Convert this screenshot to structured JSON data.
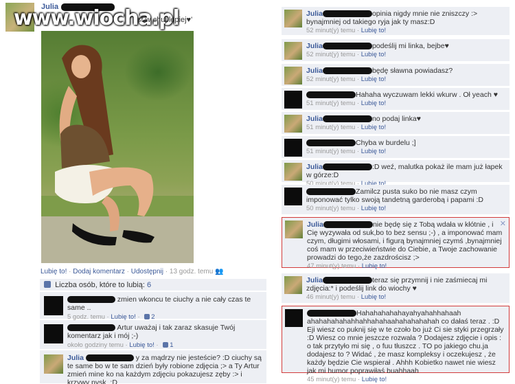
{
  "watermark": "www.wiocha.pl",
  "post": {
    "author": "Julia",
    "text": "st w chuj lepiej♥'",
    "actions": {
      "like": "Lubię to!",
      "comment": "Dodaj komentarz",
      "share": "Udostępnij",
      "time": "13 godz. temu"
    }
  },
  "likes": {
    "label": "Liczba osób, które to lubią:",
    "count": "6"
  },
  "left_comments": [
    {
      "author": "",
      "text": "zmien wkoncu te ciuchy a nie cały czas te same ..",
      "time": "5 godz. temu",
      "like": "Lubię to!",
      "likes": "2",
      "avatar": "dark"
    },
    {
      "author": "",
      "text": "Artur uważaj i tak zaraz skasuje Twój komentarz jak i mój ;-)",
      "time": "około godziny temu",
      "like": "Lubię to!",
      "likes": "1",
      "avatar": "dark"
    },
    {
      "author": "Julia",
      "text": "y za mądrzy nie jesteście? :D ciuchy są te same bo w te sam dzień były robione zdjęcia ;> a Ty Artur zmień mine ko na każdym zdjęciu pokazujesz zęby :> i krzywy pysk .:D",
      "time": "",
      "like": "",
      "likes": "",
      "avatar": "julia"
    }
  ],
  "right_comments": [
    {
      "author": "Julia",
      "text": "opinia nigdy mnie nie zniszczy :> bynajmniej od takiego ryja jak ty masz:D",
      "time": "52 minut(y) temu",
      "like": "Lubię to!",
      "avatar": "julia"
    },
    {
      "author": "Julia",
      "text": "podeślij mi linka, bejbe♥",
      "time": "52 minut(y) temu",
      "like": "Lubię to!",
      "avatar": "julia"
    },
    {
      "author": "Julia",
      "text": "będę sławna powiadasz?",
      "time": "52 minut(y) temu",
      "like": "Lubię to!",
      "avatar": "julia"
    },
    {
      "author": "",
      "text": "Hahaha wyczuwam lekki wkurw . Oł yeach ♥",
      "time": "51 minut(y) temu",
      "like": "Lubię to!",
      "avatar": "dark"
    },
    {
      "author": "Julia",
      "text": "no podaj linka♥",
      "time": "51 minut(y) temu",
      "like": "Lubię to!",
      "avatar": "julia"
    },
    {
      "author": "",
      "text": "Chyba w burdelu ;]",
      "time": "51 minut(y) temu",
      "like": "Lubię to!",
      "avatar": "dark"
    },
    {
      "author": "Julia",
      "text": ":D weź, malutka pokaż ile mam już łapek w górze:D",
      "time": "50 minut(y) temu",
      "like": "Lubię to!",
      "avatar": "julia"
    },
    {
      "author": "",
      "text": "Zamilcz pusta suko bo nie masz czym imponować tylko swoją tandetną garderobą i papami :D",
      "time": "50 minut(y) temu",
      "like": "Lubię to!",
      "avatar": "dark"
    },
    {
      "author": "Julia",
      "text": "nie będę się z Tobą wdała w kłótnie , i Cię wyzywała od suk,bo to bez sensu ;-) , a imponować mam czym, długimi włosami, i figurą bynajmniej czymś ,bynajmniej coś mam w przeciwieństwie do Ciebie, a Twoje zachowanie prowadzi do tego,że zazdrościsz ;>",
      "time": "47 minut(y) temu",
      "like": "Lubię to!",
      "avatar": "julia",
      "close": "✕"
    },
    {
      "author": "Julia",
      "text": "teraz się przymnij i nie zaśmiecaj mi zdjęcia:* i podeślij link do wiochy ♥",
      "time": "46 minut(y) temu",
      "like": "Lubię to!",
      "avatar": "julia"
    },
    {
      "author": "",
      "text": "Hahahahahahayahyahahhahaah ahahahahahahhahhahahaahahahahahah co dałaś teraz . :D Eji wiesz co puknij się w te czoło bo już Ci sie styki przegrzały :D Wiesz co mnie jeszcze rozwala ? Dodajesz zdjęcie i opis : o tak przytyło mi się , o fuu tłuszcz . TO po jakiego chu.ja dodajesz to ? Widać , że masz kompleksy i oczekujesz , że każdy będzie Cie wspierał . Ahhh Kobietko nawet nie wiesz jak mi humor poprawiłaś buahhaah",
      "time": "45 minut(y) temu",
      "like": "Lubię to!",
      "avatar": "dark"
    }
  ],
  "colors": {
    "link": "#3b5998",
    "comment_bg": "#edeff4",
    "highlight": "#d23a3a",
    "meta": "#999999"
  }
}
